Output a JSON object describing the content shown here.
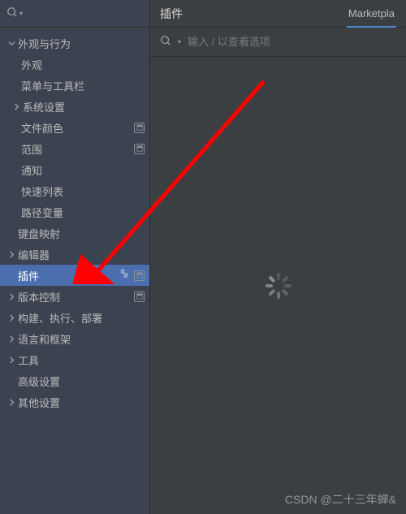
{
  "header": {
    "title": "插件",
    "tab": "Marketpla"
  },
  "main_search": {
    "placeholder": "输入 / 以查看选项"
  },
  "watermark": "CSDN @二十三年蝉&",
  "sidebar": {
    "items": [
      {
        "label": "外观与行为",
        "level": 0,
        "arrow": "down",
        "badge": false
      },
      {
        "label": "外观",
        "level": 1,
        "arrow": null,
        "badge": false
      },
      {
        "label": "菜单与工具栏",
        "level": 1,
        "arrow": null,
        "badge": false
      },
      {
        "label": "系统设置",
        "level": 1,
        "arrow": "right",
        "badge": false,
        "hasArrow": true
      },
      {
        "label": "文件颜色",
        "level": 1,
        "arrow": null,
        "badge": true
      },
      {
        "label": "范围",
        "level": 1,
        "arrow": null,
        "badge": true
      },
      {
        "label": "通知",
        "level": 1,
        "arrow": null,
        "badge": false
      },
      {
        "label": "快速列表",
        "level": 1,
        "arrow": null,
        "badge": false
      },
      {
        "label": "路径变量",
        "level": 1,
        "arrow": null,
        "badge": false
      },
      {
        "label": "键盘映射",
        "level": 0,
        "arrow": null,
        "badge": false
      },
      {
        "label": "编辑器",
        "level": 0,
        "arrow": "right",
        "badge": false
      },
      {
        "label": "插件",
        "level": 0,
        "arrow": null,
        "badge": true,
        "selected": true,
        "translate": true
      },
      {
        "label": "版本控制",
        "level": 0,
        "arrow": "right",
        "badge": true
      },
      {
        "label": "构建、执行、部署",
        "level": 0,
        "arrow": "right",
        "badge": false
      },
      {
        "label": "语言和框架",
        "level": 0,
        "arrow": "right",
        "badge": false
      },
      {
        "label": "工具",
        "level": 0,
        "arrow": "right",
        "badge": false
      },
      {
        "label": "高级设置",
        "level": 0,
        "arrow": null,
        "badge": false
      },
      {
        "label": "其他设置",
        "level": 0,
        "arrow": "right",
        "badge": false
      }
    ]
  }
}
